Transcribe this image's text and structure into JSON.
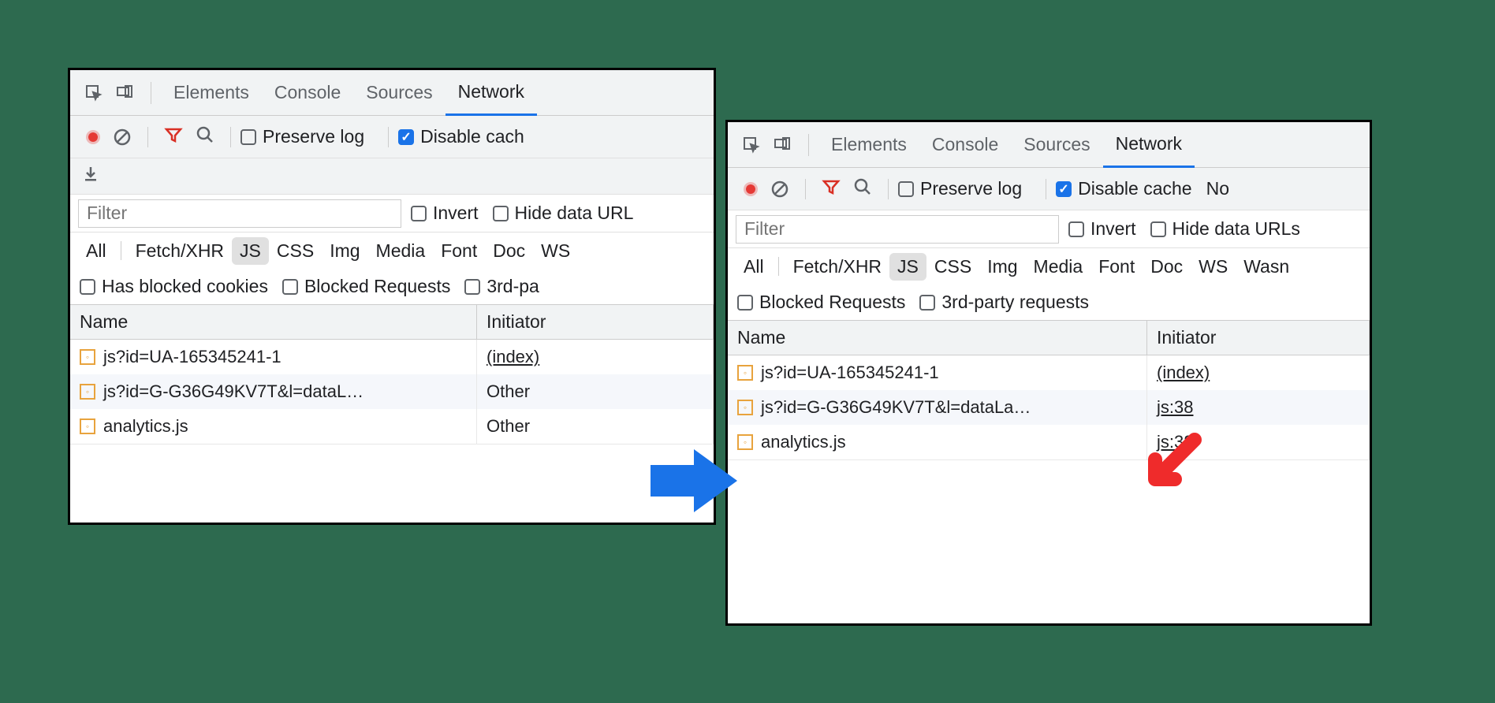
{
  "tabs": {
    "elements": "Elements",
    "console": "Console",
    "sources": "Sources",
    "network": "Network"
  },
  "toolbar": {
    "preserve_log": "Preserve log",
    "disable_cache_left": "Disable cach",
    "disable_cache_right": "Disable cache",
    "no_right": "No"
  },
  "filter": {
    "placeholder": "Filter",
    "invert": "Invert",
    "hide_urls_left": "Hide data URL",
    "hide_urls_right": "Hide data URLs"
  },
  "types": {
    "all": "All",
    "fetch": "Fetch/XHR",
    "js": "JS",
    "css": "CSS",
    "img": "Img",
    "media": "Media",
    "font": "Font",
    "doc": "Doc",
    "ws": "WS",
    "wasm": "Wasn"
  },
  "chkrow": {
    "blocked_cookies": "Has blocked cookies",
    "blocked_requests": "Blocked Requests",
    "third_party_left": "3rd-pa",
    "third_party_right": "3rd-party requests"
  },
  "columns": {
    "name": "Name",
    "initiator": "Initiator"
  },
  "left_rows": [
    {
      "name": "js?id=UA-165345241-1",
      "initiator": "(index)",
      "link": true
    },
    {
      "name": "js?id=G-G36G49KV7T&l=dataL…",
      "initiator": "Other",
      "link": false
    },
    {
      "name": "analytics.js",
      "initiator": "Other",
      "link": false
    }
  ],
  "right_rows": [
    {
      "name": "js?id=UA-165345241-1",
      "initiator": "(index)"
    },
    {
      "name": "js?id=G-G36G49KV7T&l=dataLa…",
      "initiator": "js:38"
    },
    {
      "name": "analytics.js",
      "initiator": "js:38"
    }
  ]
}
